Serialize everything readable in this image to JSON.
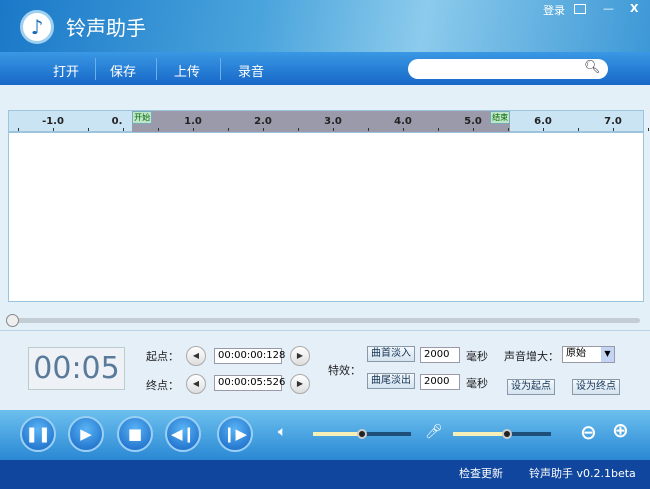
{
  "title": "铃声助手",
  "window": {
    "login": "登录",
    "menu_icon": "dropdown-icon",
    "minimize": "—",
    "close": "X"
  },
  "toolbar": {
    "items": [
      "打开",
      "保存",
      "上传",
      "录音"
    ],
    "search_placeholder": ""
  },
  "ruler": {
    "labels": [
      "-1.0",
      "0.",
      "1.0",
      "2.0",
      "3.0",
      "4.0",
      "5.0",
      "6.0",
      "7.0"
    ],
    "start_marker": "开始",
    "end_marker": "结束",
    "selection_start": 0.13,
    "selection_end": 5.53
  },
  "scroll_position": 0,
  "panel": {
    "clock": "00:05",
    "start_label": "起点：",
    "start_value": "00:00:00:128",
    "end_label": "终点：",
    "end_value": "00:00:05:526",
    "effects_label": "特效：",
    "fade_in": "曲首淡入",
    "fade_in_ms": "2000",
    "fade_out": "曲尾淡出",
    "fade_out_ms": "2000",
    "ms_unit": "毫秒",
    "boost_label": "声音增大：",
    "boost_value": "原始",
    "set_start": "设为起点",
    "set_end": "设为终点"
  },
  "player": {
    "volume": 0.5,
    "mic_volume": 0.55
  },
  "status": {
    "check_update": "检查更新",
    "version": "铃声助手 v0.2.1beta"
  }
}
